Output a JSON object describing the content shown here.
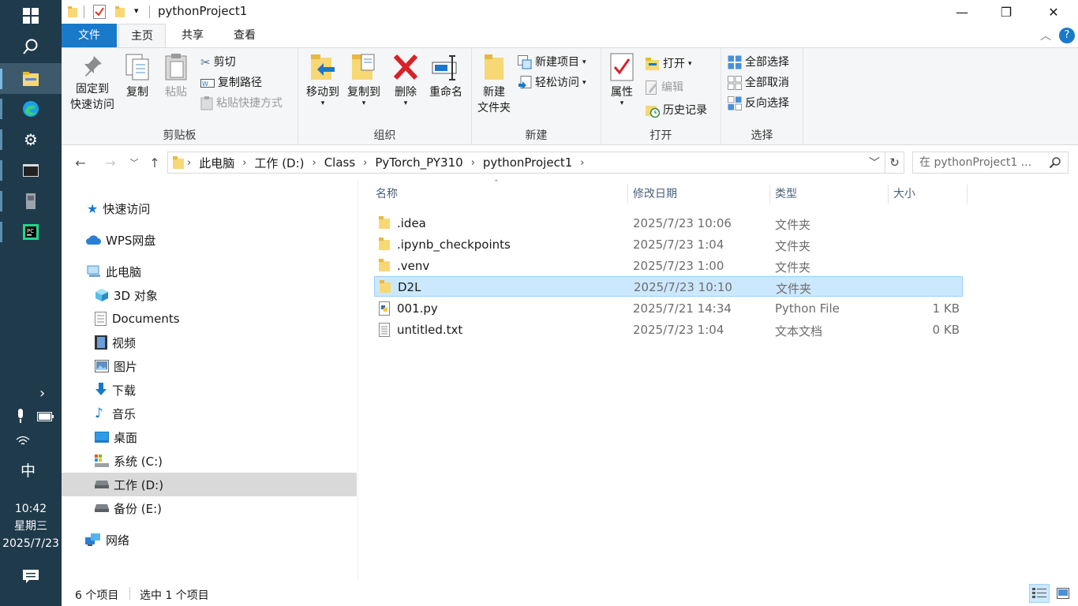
{
  "window": {
    "title": "pythonProject1",
    "minimize": "—",
    "maximize": "❐",
    "close": "✕"
  },
  "ribbon_tabs": [
    {
      "label": "文件"
    },
    {
      "label": "主页"
    },
    {
      "label": "共享"
    },
    {
      "label": "查看"
    }
  ],
  "ribbon": {
    "clipboard": {
      "label": "剪贴板",
      "pin_line1": "固定到",
      "pin_line2": "快速访问",
      "copy": "复制",
      "paste": "粘贴",
      "cut": "剪切",
      "copy_path": "复制路径",
      "paste_shortcut": "粘贴快捷方式"
    },
    "organize": {
      "label": "组织",
      "move_to": "移动到",
      "copy_to": "复制到",
      "delete": "删除",
      "rename": "重命名"
    },
    "new": {
      "label": "新建",
      "new_folder_line1": "新建",
      "new_folder_line2": "文件夹",
      "new_item": "新建项目",
      "easy_access": "轻松访问"
    },
    "open": {
      "label": "打开",
      "properties": "属性",
      "open": "打开",
      "edit": "编辑",
      "history": "历史记录"
    },
    "select": {
      "label": "选择",
      "select_all": "全部选择",
      "select_none": "全部取消",
      "invert": "反向选择"
    }
  },
  "address": {
    "breadcrumb": [
      "此电脑",
      "工作 (D:)",
      "Class",
      "PyTorch_PY310",
      "pythonProject1"
    ],
    "search_placeholder": "在 pythonProject1 ..."
  },
  "nav": {
    "quick_access": "快速访问",
    "wps": "WPS网盘",
    "this_pc": "此电脑",
    "items": [
      "3D 对象",
      "Documents",
      "视频",
      "图片",
      "下载",
      "音乐",
      "桌面",
      "系统 (C:)",
      "工作 (D:)",
      "备份 (E:)"
    ],
    "network": "网络"
  },
  "columns": {
    "name": "名称",
    "date": "修改日期",
    "type": "类型",
    "size": "大小"
  },
  "files": [
    {
      "name": ".idea",
      "date": "2025/7/23 10:06",
      "type": "文件夹",
      "size": "",
      "icon": "folder-icon"
    },
    {
      "name": ".ipynb_checkpoints",
      "date": "2025/7/23 1:04",
      "type": "文件夹",
      "size": "",
      "icon": "folder-icon"
    },
    {
      "name": ".venv",
      "date": "2025/7/23 1:00",
      "type": "文件夹",
      "size": "",
      "icon": "folder-icon"
    },
    {
      "name": "D2L",
      "date": "2025/7/23 10:10",
      "type": "文件夹",
      "size": "",
      "icon": "folder-icon",
      "selected": true
    },
    {
      "name": "001.py",
      "date": "2025/7/21 14:34",
      "type": "Python File",
      "size": "1 KB",
      "icon": "python-file-icon"
    },
    {
      "name": "untitled.txt",
      "date": "2025/7/23 1:04",
      "type": "文本文档",
      "size": "0 KB",
      "icon": "text-file-icon"
    }
  ],
  "status": {
    "count": "6 个项目",
    "selected": "选中 1 个项目"
  },
  "taskbar": {
    "ime": "中",
    "time": "10:42",
    "weekday": "星期三",
    "date": "2025/7/23"
  },
  "colors": {
    "accent": "#1979ca",
    "selection": "#cce8ff",
    "taskbar": "#1f3a4b",
    "folder": "#f8d775"
  }
}
